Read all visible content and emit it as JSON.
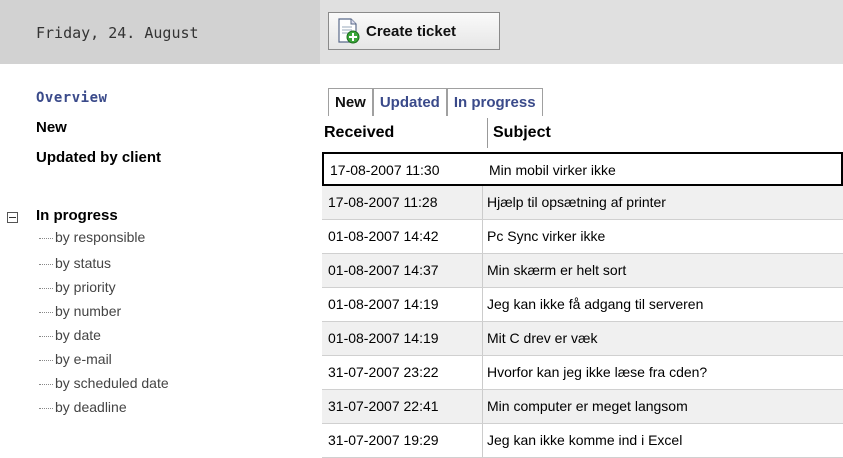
{
  "header": {
    "date": "Friday, 24. August",
    "create_ticket_label": "Create ticket"
  },
  "sidebar": {
    "overview": "Overview",
    "new": "New",
    "updated_by_client": "Updated by client",
    "in_progress": "In progress",
    "sub_items": [
      "by responsible",
      "by status",
      "by priority",
      "by number",
      "by date",
      "by e-mail",
      "by scheduled date",
      "by deadline"
    ]
  },
  "tabs": [
    "New",
    "Updated",
    "In progress"
  ],
  "table": {
    "columns": [
      "Received",
      "Subject"
    ],
    "rows": [
      [
        "17-08-2007 11:30",
        "Min mobil virker ikke"
      ],
      [
        "17-08-2007 11:28",
        "Hjælp til opsætning af printer"
      ],
      [
        "01-08-2007 14:42",
        "Pc Sync virker ikke"
      ],
      [
        "01-08-2007 14:37",
        "Min skærm er helt sort"
      ],
      [
        "01-08-2007 14:19",
        "Jeg kan ikke få adgang til serveren"
      ],
      [
        "01-08-2007 14:19",
        "Mit C drev er væk"
      ],
      [
        "31-07-2007 23:22",
        "Hvorfor kan jeg ikke læse fra cden?"
      ],
      [
        "31-07-2007 22:41",
        "Min computer er meget langsom"
      ],
      [
        "31-07-2007 19:29",
        "Jeg kan ikke komme ind i Excel"
      ]
    ]
  },
  "colors": {
    "link_blue": "#3a4a8a",
    "topbar_left": "#d2d2d2",
    "topbar_right": "#e0e0e0"
  }
}
